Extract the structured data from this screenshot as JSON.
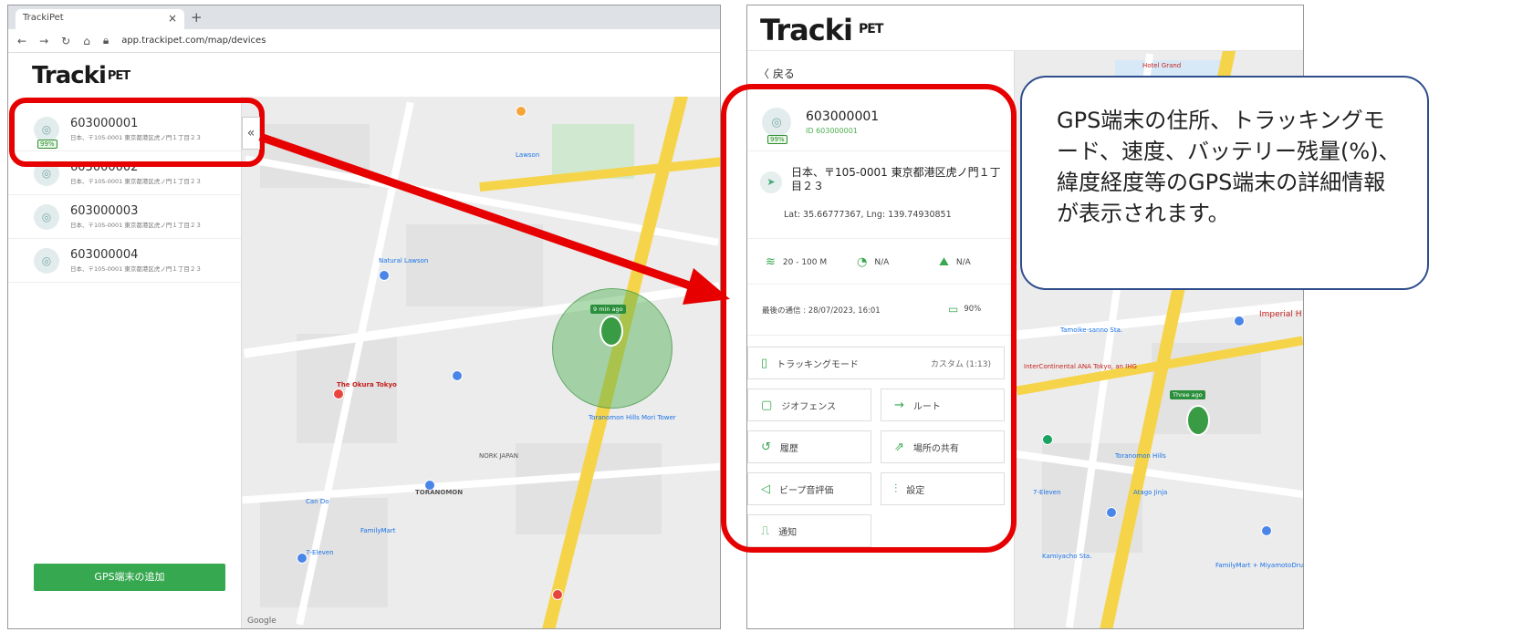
{
  "left": {
    "tab_title": "TrackiPet",
    "url": "app.trackipet.com/map/devices",
    "logo": "Tracki",
    "logo_suffix": "PET",
    "collapse_icon": "chevrons-left-icon",
    "devices": [
      {
        "name": "603000001",
        "address": "日本、〒105-0001 東京都港区虎ノ門１丁目２３"
      },
      {
        "name": "603000002",
        "address": "日本、〒105-0001 東京都港区虎ノ門１丁目２３"
      },
      {
        "name": "603000003",
        "address": "日本、〒105-0001 東京都港区虎ノ門１丁目２３"
      },
      {
        "name": "603000004",
        "address": "日本、〒105-0001 東京都港区虎ノ門１丁目２３"
      }
    ],
    "add_button": "GPS端末の追加",
    "map": {
      "geofence_tag": "9 min ago",
      "labels": [
        "Natural Lawson",
        "The Okura Tokyo",
        "Toranomon Hills Mori Tower",
        "TORANOMON",
        "NORK JAPAN",
        "7-Eleven",
        "FamilyMart",
        "Can Do",
        "Lawson",
        "Google"
      ]
    }
  },
  "right": {
    "logo": "Tracki",
    "logo_suffix": "PET",
    "back_label": "戻る",
    "device_name": "603000001",
    "device_id": "ID 603000001",
    "battery_badge": "99%",
    "address": "日本、〒105-0001 東京都港区虎ノ門１丁目２３",
    "latlng": "Lat: 35.66777367, Lng: 139.74930851",
    "stats": {
      "signal": "20 - 100 M",
      "speed": "N/A",
      "altitude": "N/A"
    },
    "last_report": "最後の通信 : 28/07/2023, 16:01",
    "battery": "90%",
    "tracking_mode_label": "トラッキングモード",
    "tracking_mode_value": "カスタム (1:13)",
    "buttons": {
      "geofence": "ジオフェンス",
      "route": "ルート",
      "history": "履歴",
      "share": "場所の共有",
      "beep": "ビープ音評価",
      "settings": "設定",
      "notify": "通知"
    },
    "map": {
      "tag": "Three ago",
      "labels": [
        "Hotel Grand",
        "Toranomon Hills",
        "Tamoike-sanno Sta.",
        "InterContinental ANA Tokyo, an IHG",
        "Imperial H",
        "Kamiyacho Sta.",
        "FamilyMart + MiyamotoDrug",
        "Atago Jinja",
        "7-Eleven"
      ]
    }
  },
  "callout": {
    "text": "GPS端末の住所、トラッキングモード、速度、バッテリー残量(%)、緯度経度等のGPS端末の詳細情報が表示されます。"
  }
}
